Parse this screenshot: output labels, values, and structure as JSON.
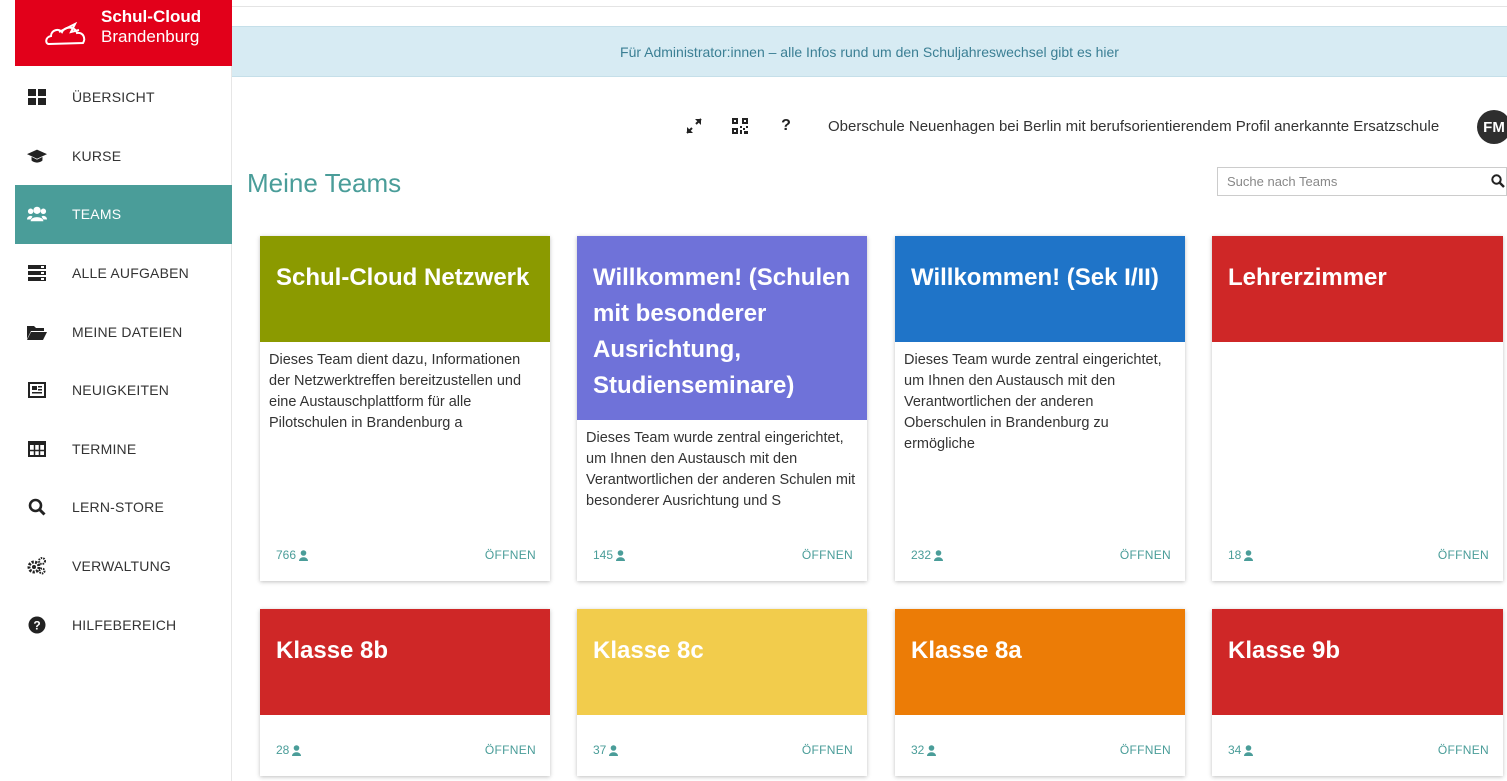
{
  "brand": {
    "line1": "Schul-Cloud",
    "line2": "Brandenburg"
  },
  "sidebar": {
    "items": [
      {
        "label": "ÜBERSICHT",
        "icon": "dashboard-icon"
      },
      {
        "label": "KURSE",
        "icon": "graduation-cap-icon"
      },
      {
        "label": "TEAMS",
        "icon": "users-icon",
        "active": true
      },
      {
        "label": "ALLE AUFGABEN",
        "icon": "tasks-icon"
      },
      {
        "label": "MEINE DATEIEN",
        "icon": "folder-icon"
      },
      {
        "label": "NEUIGKEITEN",
        "icon": "newspaper-icon"
      },
      {
        "label": "TERMINE",
        "icon": "calendar-table-icon"
      },
      {
        "label": "LERN-STORE",
        "icon": "search-icon"
      },
      {
        "label": "VERWALTUNG",
        "icon": "cogs-icon"
      },
      {
        "label": "HILFEBEREICH",
        "icon": "help-circle-icon"
      }
    ]
  },
  "banner": {
    "text": "Für Administrator:innen – alle Infos",
    "link": "rund um den Schuljahreswechsel gibt es hier"
  },
  "topbar": {
    "help": "?",
    "school_name": "Oberschule Neuenhagen bei Berlin mit berufsorientierendem Profil anerkannte Ersatzschule",
    "avatar_initials": "FM"
  },
  "page": {
    "title": "Meine Teams",
    "search_placeholder": "Suche nach Teams"
  },
  "open_label": "ÖFFNEN",
  "teams": [
    {
      "title": "Schul-Cloud Netzwerk",
      "color": "#8b9a00",
      "description": "Dieses Team dient dazu, Informationen der Netzwerktreffen bereitzustellen und eine Austauschplattform für alle Pilotschulen in Brandenburg a",
      "members": "766"
    },
    {
      "title": "Willkommen! (Schulen mit besonderer Ausrichtung, Studienseminare)",
      "color": "#6f72d9",
      "description": "Dieses Team wurde zentral eingerichtet, um Ihnen den Austausch mit den Verantwortlichen der anderen Schulen mit besonderer Ausrichtung und S",
      "members": "145"
    },
    {
      "title": "Willkommen! (Sek I/II)",
      "color": "#1f74c8",
      "description": "Dieses Team wurde zentral eingerichtet, um Ihnen den Austausch mit den Verantwortlichen der anderen Oberschulen in Brandenburg zu ermögliche",
      "members": "232"
    },
    {
      "title": "Lehrerzimmer",
      "color": "#cf2727",
      "description": "",
      "members": "18"
    },
    {
      "title": "Klasse 8b",
      "color": "#cf2727",
      "description": "",
      "members": "28"
    },
    {
      "title": "Klasse 8c",
      "color": "#f2cc4c",
      "description": "",
      "members": "37"
    },
    {
      "title": "Klasse 8a",
      "color": "#ec7c06",
      "description": "",
      "members": "32"
    },
    {
      "title": "Klasse 9b",
      "color": "#cf2727",
      "description": "",
      "members": "34"
    }
  ]
}
